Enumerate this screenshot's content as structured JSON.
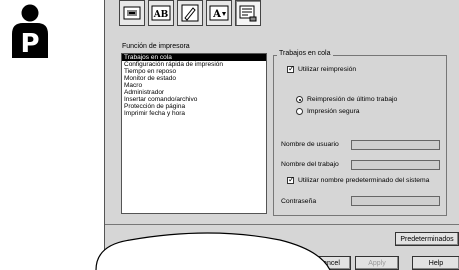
{
  "list": {
    "label": "Función de impresora",
    "items": [
      "Trabajos en cola",
      "Configuración rápida de impresión",
      "Tiempo en reposo",
      "Monitor de estado",
      "Macro",
      "Administrador",
      "Insertar comando/archivo",
      "Protección de página",
      "Imprimir fecha y hora"
    ],
    "selected_index": 0
  },
  "group": {
    "title": "Trabajos en cola",
    "use_reprint_label": "Utilizar reimpresión",
    "use_reprint_checked": true,
    "radio_last_job_label": "Reimpresión de último trabajo",
    "radio_last_job_checked": true,
    "radio_secure_label": "Impresión segura",
    "radio_secure_checked": false,
    "username_label": "Nombre de usuario",
    "jobname_label": "Nombre del trabajo",
    "default_name_label": "Utilizar nombre predeterminado del sistema",
    "default_name_checked": true,
    "password_label": "Contraseña"
  },
  "buttons": {
    "defaults": "Predeterminados",
    "cancel": "Cancel",
    "apply": "Apply",
    "help": "Help"
  },
  "toolbar": {
    "icons": [
      "printer-settings-icon",
      "ab-text-icon",
      "pen-icon",
      "font-size-icon",
      "job-queue-icon"
    ]
  }
}
